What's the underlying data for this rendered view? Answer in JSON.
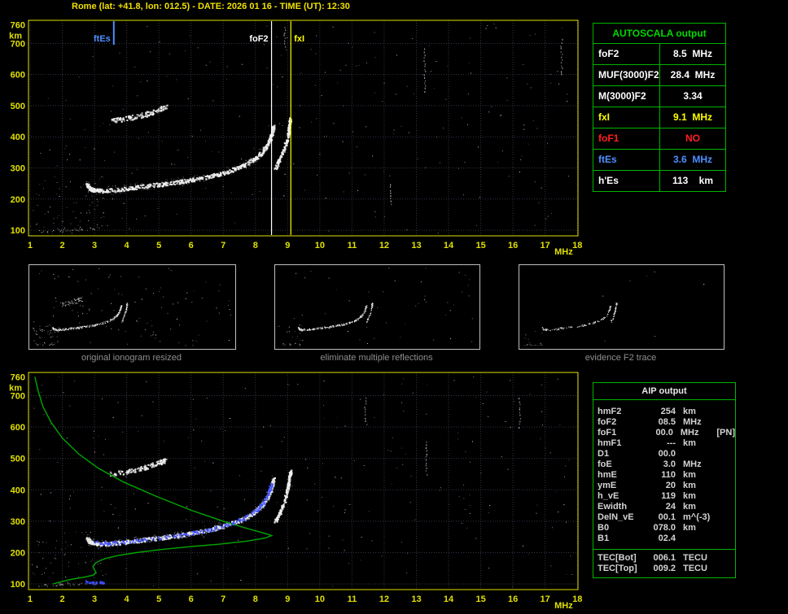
{
  "header": {
    "title": "Rome (lat: +41.8, lon: 012.5) - DATE: 2026 01 16 - TIME (UT): 12:30"
  },
  "colors": {
    "background": "#000000",
    "axis": "#e0e000",
    "grid": "#34344a",
    "trace": "#f0f0f0",
    "trace_fuzz": "#c8c8c8",
    "profile_green": "#00a800",
    "restored_blue": "#4050ff",
    "table_green": "#00b400",
    "caption_gray": "#8f8f8f",
    "marker_blue": "#4f8fff",
    "marker_white": "#ffffff",
    "marker_yellow": "#ffff00",
    "red": "#ff2020"
  },
  "autoscala_table": {
    "title": "AUTOSCALA output",
    "rows": [
      {
        "label": "foF2",
        "value": "8.5  MHz",
        "color": "#ffffff"
      },
      {
        "label": "MUF(3000)F2",
        "value": "28.4  MHz",
        "color": "#ffffff"
      },
      {
        "label": "M(3000)F2",
        "value": "3.34",
        "color": "#ffffff"
      },
      {
        "label": "fxI",
        "value": "9.1  MHz",
        "color": "#ffff00"
      },
      {
        "label": "foF1",
        "value": "NO",
        "color": "#ff2020"
      },
      {
        "label": "ftEs",
        "value": "3.6  MHz",
        "color": "#4f8fff"
      },
      {
        "label": "h'Es",
        "value": "113    km",
        "color": "#ffffff"
      }
    ]
  },
  "aip_table": {
    "title": "AIP output",
    "rows": [
      {
        "name": "hmF2",
        "value": "254",
        "unit": "km",
        "extra": ""
      },
      {
        "name": "foF2",
        "value": "08.5",
        "unit": "MHz",
        "extra": ""
      },
      {
        "name": "foF1",
        "value": "00.0",
        "unit": "MHz",
        "extra": "[PN]"
      },
      {
        "name": "hmF1",
        "value": "---",
        "unit": "km",
        "extra": ""
      },
      {
        "name": "D1",
        "value": "00.0",
        "unit": "",
        "extra": ""
      },
      {
        "name": "foE",
        "value": "3.0",
        "unit": "MHz",
        "extra": ""
      },
      {
        "name": "hmE",
        "value": "110",
        "unit": "km",
        "extra": ""
      },
      {
        "name": "ymE",
        "value": "20",
        "unit": "km",
        "extra": ""
      },
      {
        "name": "h_vE",
        "value": "119",
        "unit": "km",
        "extra": ""
      },
      {
        "name": "Ewidth",
        "value": "24",
        "unit": "km",
        "extra": ""
      },
      {
        "name": "DelN_vE",
        "value": "00.1",
        "unit": "m^(-3)",
        "extra": ""
      },
      {
        "name": "B0",
        "value": "078.0",
        "unit": "km",
        "extra": ""
      },
      {
        "name": "B1",
        "value": "02.4",
        "unit": "",
        "extra": ""
      }
    ],
    "tec_rows": [
      {
        "name": "TEC[Bot]",
        "value": "006.1",
        "unit": "TECU"
      },
      {
        "name": "TEC[Top]",
        "value": "009.2",
        "unit": "TECU"
      }
    ]
  },
  "thumbnails": [
    {
      "caption": "original ionogram resized"
    },
    {
      "caption": "eliminate multiple reflections"
    },
    {
      "caption": "evidence F2 trace"
    }
  ],
  "chart_data": {
    "type": "scatter",
    "xlabel": "MHz",
    "ylabel": "km",
    "xlim": [
      0.95,
      18.02
    ],
    "ylim": [
      82,
      774
    ],
    "x_ticks": [
      1,
      2,
      3,
      4,
      5,
      6,
      7,
      8,
      9,
      10,
      11,
      12,
      13,
      14,
      15,
      16,
      17,
      18
    ],
    "y_ticks": [
      760,
      700,
      600,
      500,
      400,
      300,
      200,
      100
    ],
    "grid": true,
    "seed": 20260116,
    "traces": {
      "f2_ordinary": [
        [
          2.75,
          248
        ],
        [
          2.85,
          234
        ],
        [
          3.1,
          228
        ],
        [
          3.5,
          230
        ],
        [
          4.0,
          236
        ],
        [
          4.5,
          242
        ],
        [
          5.0,
          248
        ],
        [
          5.5,
          255
        ],
        [
          6.0,
          263
        ],
        [
          6.5,
          273
        ],
        [
          7.0,
          286
        ],
        [
          7.5,
          303
        ],
        [
          7.9,
          325
        ],
        [
          8.2,
          352
        ],
        [
          8.4,
          382
        ],
        [
          8.5,
          412
        ],
        [
          8.56,
          436
        ]
      ],
      "f2_extraordinary": [
        [
          8.6,
          300
        ],
        [
          8.75,
          330
        ],
        [
          8.9,
          370
        ],
        [
          9.0,
          410
        ],
        [
          9.05,
          445
        ],
        [
          9.08,
          460
        ]
      ],
      "multiple_reflection": [
        [
          3.5,
          452
        ],
        [
          3.9,
          458
        ],
        [
          4.3,
          466
        ],
        [
          4.7,
          477
        ],
        [
          5.0,
          488
        ],
        [
          5.2,
          497
        ]
      ],
      "e_region": [
        [
          1.2,
          96
        ],
        [
          1.8,
          98
        ],
        [
          2.4,
          101
        ],
        [
          3.0,
          105
        ]
      ]
    },
    "top_plot": {
      "markers": [
        {
          "label": "ftEs",
          "freq": 3.6,
          "color": "#4f8fff",
          "full_height": false,
          "label_side": "left"
        },
        {
          "label": "foF2",
          "freq": 8.5,
          "color": "#ffffff",
          "full_height": true,
          "label_side": "left"
        },
        {
          "label": "fxI",
          "freq": 9.1,
          "color": "#ffff00",
          "full_height": true,
          "label_side": "right"
        }
      ],
      "streaks": [
        {
          "f": 13.25,
          "km": [
            545,
            690
          ]
        },
        {
          "f": 12.2,
          "km": [
            185,
            255
          ]
        },
        {
          "f": 17.5,
          "km": [
            600,
            720
          ]
        },
        {
          "f": 8.9,
          "km": [
            690,
            760
          ]
        }
      ],
      "noise_count": 300
    },
    "bottom_plot": {
      "profile_green": [
        [
          1.15,
          760
        ],
        [
          1.25,
          715
        ],
        [
          1.4,
          665
        ],
        [
          1.65,
          615
        ],
        [
          2.0,
          565
        ],
        [
          2.5,
          515
        ],
        [
          3.1,
          470
        ],
        [
          3.9,
          425
        ],
        [
          4.9,
          380
        ],
        [
          6.0,
          335
        ],
        [
          7.0,
          300
        ],
        [
          7.8,
          275
        ],
        [
          8.3,
          261
        ],
        [
          8.5,
          254
        ],
        [
          8.3,
          246
        ],
        [
          7.7,
          236
        ],
        [
          6.9,
          227
        ],
        [
          6.0,
          219
        ],
        [
          5.1,
          210
        ],
        [
          4.3,
          200
        ],
        [
          3.7,
          190
        ],
        [
          3.3,
          180
        ],
        [
          3.05,
          168
        ],
        [
          2.95,
          156
        ],
        [
          3.0,
          145
        ],
        [
          3.05,
          136
        ],
        [
          2.95,
          128
        ],
        [
          2.7,
          122
        ],
        [
          2.4,
          117
        ],
        [
          2.15,
          112
        ],
        [
          2.0,
          108
        ],
        [
          1.85,
          104
        ],
        [
          1.7,
          100
        ]
      ],
      "restored_trace": [
        [
          2.9,
          234
        ],
        [
          3.5,
          231
        ],
        [
          4.2,
          238
        ],
        [
          5.0,
          248
        ],
        [
          5.8,
          259
        ],
        [
          6.5,
          272
        ],
        [
          7.1,
          288
        ],
        [
          7.6,
          308
        ],
        [
          8.0,
          334
        ],
        [
          8.25,
          362
        ],
        [
          8.4,
          392
        ],
        [
          8.5,
          424
        ]
      ],
      "restored_e": [
        [
          2.7,
          108
        ],
        [
          2.9,
          106
        ],
        [
          3.1,
          105
        ],
        [
          3.3,
          107
        ]
      ],
      "streaks": [
        {
          "f": 13.3,
          "km": [
            450,
            560
          ]
        },
        {
          "f": 16.2,
          "km": [
            600,
            700
          ]
        },
        {
          "f": 11.4,
          "km": [
            620,
            700
          ]
        }
      ],
      "noise_count": 280
    },
    "thumb_render": [
      {
        "noise_count": 140,
        "include_multiple": true,
        "trace_density": 260
      },
      {
        "noise_count": 60,
        "include_multiple": false,
        "trace_density": 240
      },
      {
        "noise_count": 15,
        "include_multiple": false,
        "trace_density": 130
      }
    ]
  }
}
